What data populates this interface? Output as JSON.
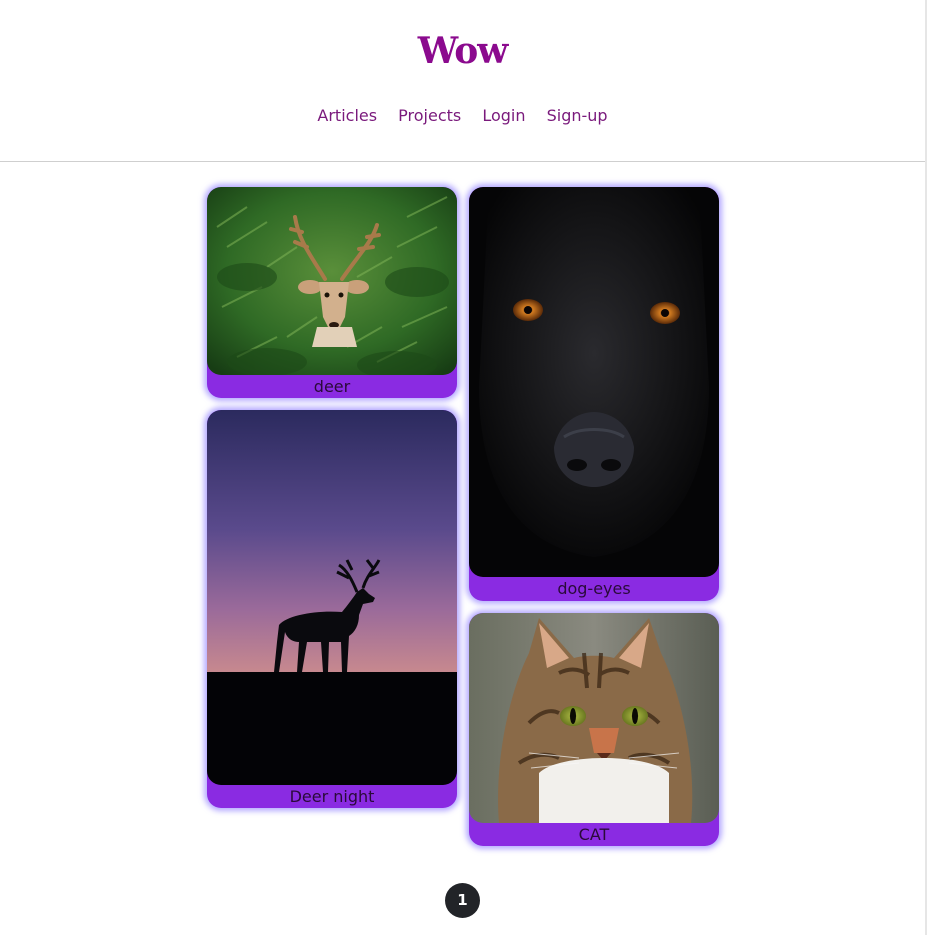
{
  "header": {
    "brand": "Wow"
  },
  "nav": {
    "items": [
      "Articles",
      "Projects",
      "Login",
      "Sign-up"
    ]
  },
  "gallery": {
    "cards": [
      {
        "caption": "deer",
        "image": "deer-in-ferns-photo"
      },
      {
        "caption": "Deer night",
        "image": "deer-silhouette-dusk-photo"
      },
      {
        "caption": "dog-eyes",
        "image": "black-dog-face-photo"
      },
      {
        "caption": "CAT",
        "image": "tabby-cat-photo"
      }
    ]
  },
  "pagination": {
    "current_page": "1"
  },
  "colors": {
    "brand": "#8b0a8e",
    "nav": "#7a1a7c",
    "card": "#8a2be2",
    "glow": "#7864ff",
    "pager": "#222428"
  }
}
